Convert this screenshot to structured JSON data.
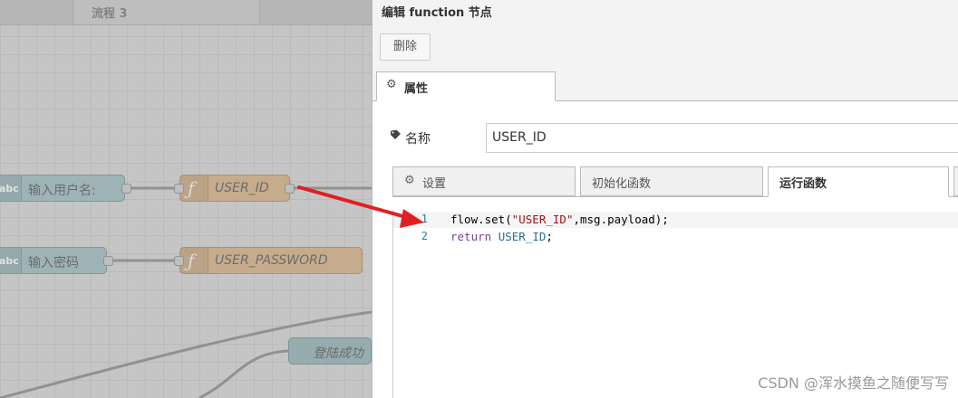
{
  "canvas": {
    "flow_tab_label": "流程 3",
    "nodes": [
      {
        "label": "输入用户名:",
        "icon": "abc"
      },
      {
        "label": "USER_ID",
        "icon": "function-icon"
      },
      {
        "label": "输入密码",
        "icon": "abc"
      },
      {
        "label": "USER_PASSWORD",
        "icon": "function-icon"
      },
      {
        "label": "登陆成功",
        "icon": ""
      }
    ]
  },
  "editor": {
    "title": "编辑 function 节点",
    "delete_label": "删除",
    "properties_tab": "属性",
    "name_label": "名称",
    "name_value": "USER_ID",
    "subtabs": [
      "设置",
      "初始化函数",
      "运行函数"
    ],
    "active_subtab": "运行函数",
    "code_lines": [
      {
        "num": "1",
        "text": "flow.set(\"USER_ID\",msg.payload);"
      },
      {
        "num": "2",
        "text": "return USER_ID;"
      }
    ]
  },
  "watermark": "CSDN @浑水摸鱼之随便写写",
  "colors": {
    "arrow": "#e02020",
    "inject_node": "#a8c4c8",
    "function_node": "#ddbb94"
  }
}
